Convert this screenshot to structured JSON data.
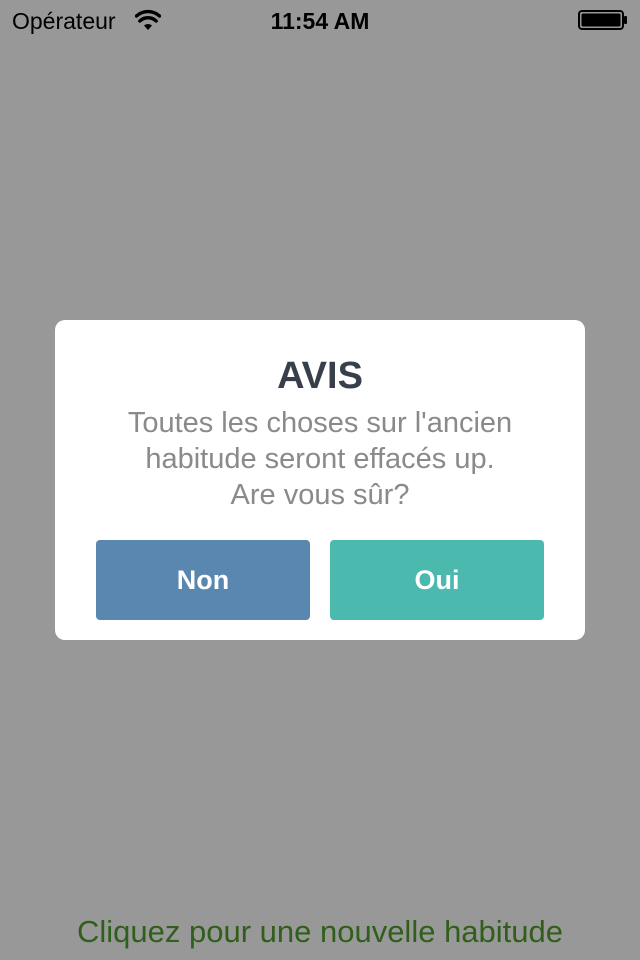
{
  "status_bar": {
    "carrier": "Opérateur",
    "time": "11:54 AM",
    "wifi_icon": "wifi-icon",
    "battery_icon": "battery-icon"
  },
  "dialog": {
    "title": "AVIS",
    "message_lines": [
      "Toutes les choses sur l'ancien",
      "habitude seront effacés up.",
      "Are vous sûr?"
    ],
    "no_button": "Non",
    "yes_button": "Oui"
  },
  "footer": {
    "new_habit_link": "Cliquez pour une nouvelle habitude"
  },
  "colors": {
    "background_overlay": "#989898",
    "no_button": "#5987af",
    "yes_button": "#4bb9ad",
    "title": "#37404a",
    "message": "#8a8a8a",
    "footer_link": "#2f5f1b"
  }
}
